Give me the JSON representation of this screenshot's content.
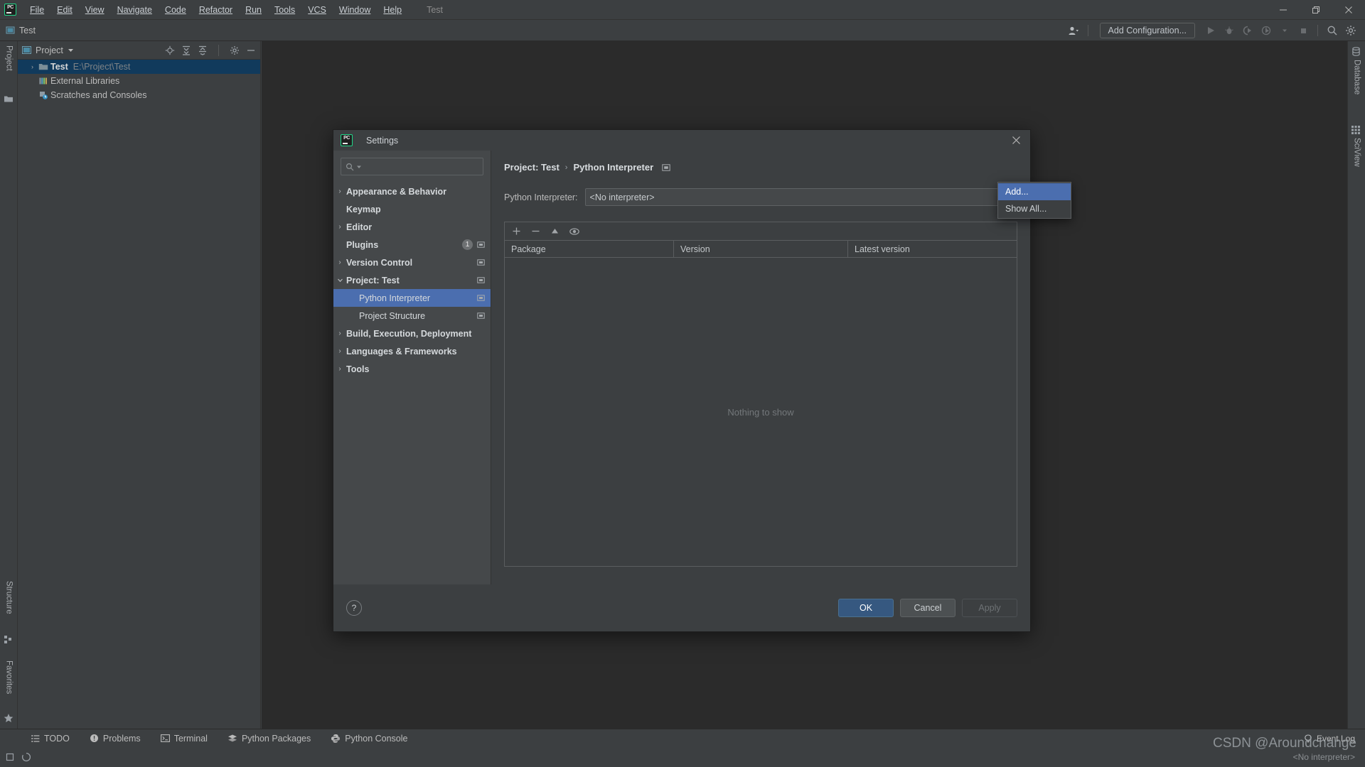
{
  "app": {
    "logo_text": "PC",
    "window_title": "Test"
  },
  "menu": {
    "items": [
      {
        "label": "File"
      },
      {
        "label": "Edit"
      },
      {
        "label": "View"
      },
      {
        "label": "Navigate"
      },
      {
        "label": "Code"
      },
      {
        "label": "Refactor"
      },
      {
        "label": "Run"
      },
      {
        "label": "Tools"
      },
      {
        "label": "VCS"
      },
      {
        "label": "Window"
      },
      {
        "label": "Help"
      }
    ]
  },
  "window_controls": {
    "minimize": "minimize-icon",
    "maximize": "maximize-icon",
    "close": "close-icon"
  },
  "toolbar": {
    "project_label": "Test",
    "add_configuration": "Add Configuration...",
    "icons": [
      "user-icon",
      "run-icon",
      "debug-icon",
      "run-coverage-icon",
      "profile-icon",
      "dropdown-icon",
      "stop-icon",
      "search-icon",
      "gear-icon"
    ]
  },
  "left_stripe": {
    "top": [
      {
        "label": "Project",
        "icon": "project-icon"
      }
    ],
    "bottom": [
      {
        "label": "Structure",
        "icon": "structure-icon"
      },
      {
        "label": "Favorites",
        "icon": "star-icon"
      }
    ]
  },
  "right_stripe": {
    "items": [
      {
        "label": "Database",
        "icon": "database-icon"
      },
      {
        "label": "SciView",
        "icon": "sciview-icon"
      }
    ]
  },
  "project_panel": {
    "title": "Project",
    "actions": [
      "locate-icon",
      "expand-all-icon",
      "collapse-all-icon",
      "gear-icon",
      "hide-icon"
    ],
    "tree": [
      {
        "label": "Test",
        "path": "E:\\Project\\Test",
        "icon": "folder-icon",
        "arrow": "›",
        "bold": true,
        "selected": true
      },
      {
        "label": "External Libraries",
        "path": "",
        "icon": "library-icon",
        "arrow": "",
        "bold": false,
        "selected": false
      },
      {
        "label": "Scratches and Consoles",
        "path": "",
        "icon": "scratches-icon",
        "arrow": "",
        "bold": false,
        "selected": false
      }
    ]
  },
  "dialog": {
    "title": "Settings",
    "close_icon": "close-icon",
    "search": {
      "placeholder": "",
      "value": "",
      "icon": "search-icon"
    },
    "tree": [
      {
        "label": "Appearance & Behavior",
        "arrow": "›",
        "bold": true,
        "indent": 0,
        "selected": false,
        "badge": "",
        "copy_icon": false
      },
      {
        "label": "Keymap",
        "arrow": "",
        "bold": true,
        "indent": 0,
        "selected": false,
        "badge": "",
        "copy_icon": false
      },
      {
        "label": "Editor",
        "arrow": "›",
        "bold": true,
        "indent": 0,
        "selected": false,
        "badge": "",
        "copy_icon": false
      },
      {
        "label": "Plugins",
        "arrow": "",
        "bold": true,
        "indent": 0,
        "selected": false,
        "badge": "1",
        "copy_icon": true
      },
      {
        "label": "Version Control",
        "arrow": "›",
        "bold": true,
        "indent": 0,
        "selected": false,
        "badge": "",
        "copy_icon": true
      },
      {
        "label": "Project: Test",
        "arrow": "⌄",
        "bold": true,
        "indent": 0,
        "selected": false,
        "badge": "",
        "copy_icon": true
      },
      {
        "label": "Python Interpreter",
        "arrow": "",
        "bold": false,
        "indent": 1,
        "selected": true,
        "badge": "",
        "copy_icon": true
      },
      {
        "label": "Project Structure",
        "arrow": "",
        "bold": false,
        "indent": 1,
        "selected": false,
        "badge": "",
        "copy_icon": true
      },
      {
        "label": "Build, Execution, Deployment",
        "arrow": "›",
        "bold": true,
        "indent": 0,
        "selected": false,
        "badge": "",
        "copy_icon": false
      },
      {
        "label": "Languages & Frameworks",
        "arrow": "›",
        "bold": true,
        "indent": 0,
        "selected": false,
        "badge": "",
        "copy_icon": false
      },
      {
        "label": "Tools",
        "arrow": "›",
        "bold": true,
        "indent": 0,
        "selected": false,
        "badge": "",
        "copy_icon": false
      }
    ],
    "breadcrumb": {
      "first": "Project: Test",
      "separator": "›",
      "second": "Python Interpreter",
      "icon": "copy-settings-icon"
    },
    "interpreter": {
      "label": "Python Interpreter:",
      "value": "<No interpreter>",
      "dropdown_icon": "chevron-down-icon"
    },
    "package_toolbar": [
      "add-icon",
      "remove-icon",
      "upgrade-icon",
      "show-early-releases-icon"
    ],
    "package_table": {
      "columns": [
        "Package",
        "Version",
        "Latest version"
      ],
      "rows": [],
      "empty_text": "Nothing to show"
    },
    "footer": {
      "help": "?",
      "ok": "OK",
      "cancel": "Cancel",
      "apply": "Apply"
    }
  },
  "popup_menu": {
    "items": [
      {
        "label": "Add...",
        "highlighted": true
      },
      {
        "label": "Show All...",
        "highlighted": false
      }
    ]
  },
  "status_bar": {
    "items": [
      {
        "label": "TODO",
        "icon": "todo-icon"
      },
      {
        "label": "Problems",
        "icon": "problems-icon"
      },
      {
        "label": "Terminal",
        "icon": "terminal-icon"
      },
      {
        "label": "Python Packages",
        "icon": "packages-icon"
      },
      {
        "label": "Python Console",
        "icon": "python-icon"
      }
    ],
    "event_log": "Event Log",
    "event_log_icon": "balloon-icon"
  },
  "bottom_bar": {
    "interpreter_status": "<No interpreter>",
    "icons": [
      "memory-icon",
      "progress-icon"
    ]
  },
  "watermark": "CSDN @Aroundchange",
  "colors": {
    "accent_blue": "#4b6eaf",
    "primary_button": "#365880",
    "tree_selected": "#113a5c",
    "panel_bg": "#3c3f41",
    "editor_bg": "#2b2b2b",
    "dialog_left_bg": "#45484a",
    "logo_green": "#21d789"
  }
}
